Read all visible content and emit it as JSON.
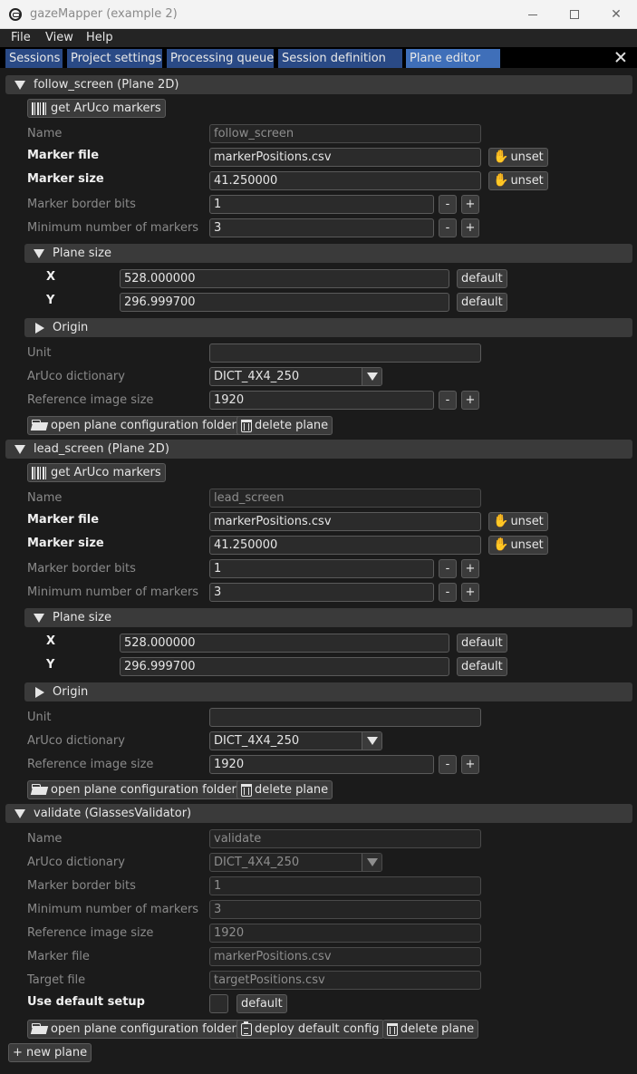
{
  "window": {
    "title": "gazeMapper (example 2)"
  },
  "menu": [
    "File",
    "View",
    "Help"
  ],
  "tabs": [
    "Sessions",
    "Project settings",
    "Processing queue",
    "Session definition",
    "Plane editor"
  ],
  "labels": {
    "get_aruco": "get ArUco markers",
    "name": "Name",
    "marker_file": "Marker file",
    "marker_size": "Marker size",
    "marker_border_bits": "Marker border bits",
    "min_markers": "Minimum number of markers",
    "plane_size": "Plane size",
    "x": "X",
    "y": "Y",
    "origin": "Origin",
    "unit": "Unit",
    "aruco_dictionary": "ArUco dictionary",
    "reference_image_size": "Reference image size",
    "target_file": "Target file",
    "use_default_setup": "Use default setup",
    "unset": "unset",
    "default": "default",
    "minus": "-",
    "plus": "+",
    "open_folder": "open plane configuration folder",
    "delete_plane": "delete plane",
    "deploy_default": "deploy default config",
    "new_plane": "+ new plane"
  },
  "planes": [
    {
      "header": "follow_screen (Plane 2D)",
      "name": "follow_screen",
      "marker_file": "markerPositions.csv",
      "marker_size": "41.250000",
      "marker_border_bits": "1",
      "min_markers": "3",
      "plane_x": "528.000000",
      "plane_y": "296.999700",
      "unit": "",
      "aruco_dictionary": "DICT_4X4_250",
      "reference_image_size": "1920"
    },
    {
      "header": "lead_screen (Plane 2D)",
      "name": "lead_screen",
      "marker_file": "markerPositions.csv",
      "marker_size": "41.250000",
      "marker_border_bits": "1",
      "min_markers": "3",
      "plane_x": "528.000000",
      "plane_y": "296.999700",
      "unit": "",
      "aruco_dictionary": "DICT_4X4_250",
      "reference_image_size": "1920"
    }
  ],
  "validator": {
    "header": "validate (GlassesValidator)",
    "name": "validate",
    "aruco_dictionary": "DICT_4X4_250",
    "marker_border_bits": "1",
    "min_markers": "3",
    "reference_image_size": "1920",
    "marker_file": "markerPositions.csv",
    "target_file": "targetPositions.csv"
  },
  "colors": {
    "tab": "#2a4a86",
    "tab_active": "#3f6fb9",
    "header": "#3a3a3a",
    "background": "#1b1b1b"
  },
  "icons": {
    "barcode": "barcode-icon",
    "folder": "folder-open-icon",
    "trash": "trash-icon",
    "clipboard": "clipboard-icon",
    "unset": "waving-hand-icon"
  }
}
